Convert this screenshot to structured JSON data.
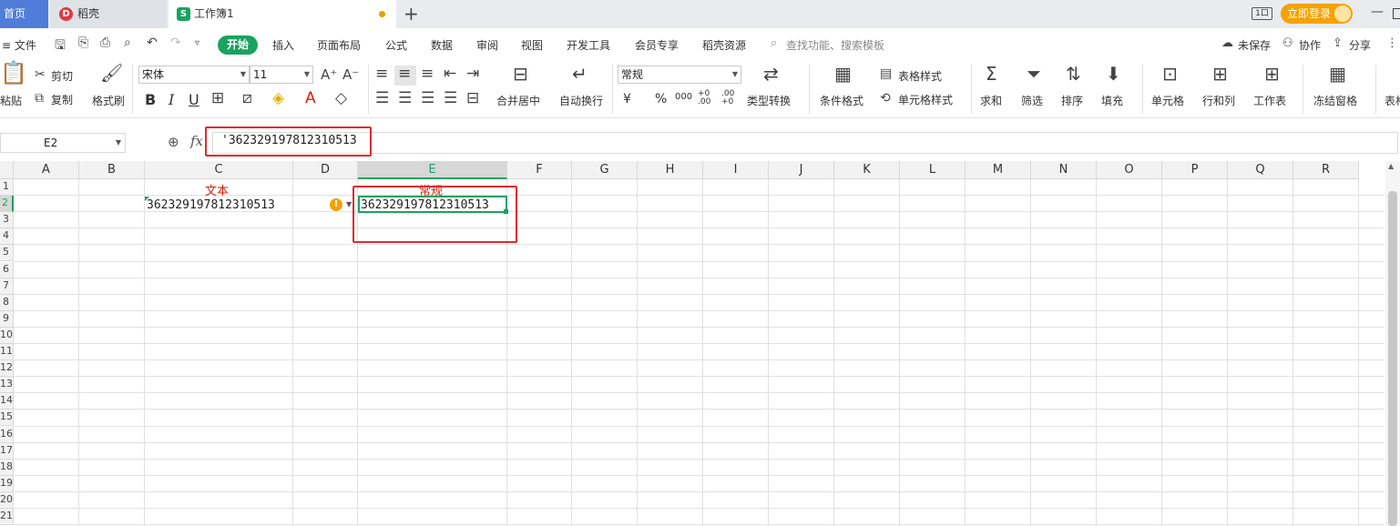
{
  "tabs": {
    "home": "首页",
    "daoke": "稻壳",
    "workbook": "工作簿1",
    "new_tab": "+"
  },
  "title_right": {
    "layout_badge": "1口",
    "login": "立即登录",
    "minimize": "—"
  },
  "menu": {
    "file": "≡ 文件",
    "items": [
      "开始",
      "插入",
      "页面布局",
      "公式",
      "数据",
      "审阅",
      "视图",
      "开发工具",
      "会员专享",
      "稻壳资源"
    ],
    "search": "查找功能、搜索模板",
    "unsaved": "未保存",
    "collab": "协作",
    "share": "分享"
  },
  "ribbon": {
    "paste": "粘贴",
    "cut": "剪切",
    "copy": "复制",
    "format_painter": "格式刷",
    "font_name": "宋体",
    "font_size": "11",
    "bold": "B",
    "italic": "I",
    "underline": "U",
    "merge_center": "合并居中",
    "wrap_text": "自动换行",
    "number_format": "常规",
    "currency": "¥",
    "percent": "%",
    "thousands": "000",
    "inc_decimal": "+0 .00",
    "dec_decimal": ".00 +0",
    "type_convert": "类型转换",
    "cond_format": "条件格式",
    "table_style": "表格样式",
    "cell_style": "单元格样式",
    "sum": "求和",
    "filter": "筛选",
    "sort": "排序",
    "fill": "填充",
    "cell": "单元格",
    "rows_cols": "行和列",
    "worksheet": "工作表",
    "freeze": "冻结窗格",
    "table_tools": "表格"
  },
  "formula_bar": {
    "name_box": "E2",
    "fx": "fx",
    "value": "'362329197812310513"
  },
  "columns": [
    "A",
    "B",
    "C",
    "D",
    "E",
    "F",
    "G",
    "H",
    "I",
    "J",
    "K",
    "L",
    "M",
    "N",
    "O",
    "P",
    "Q",
    "R"
  ],
  "rows": [
    "1",
    "2",
    "3",
    "4",
    "5",
    "6",
    "7",
    "8",
    "9",
    "10",
    "11",
    "12",
    "13",
    "14",
    "15",
    "16",
    "17",
    "18",
    "19",
    "20",
    "21"
  ],
  "cells": {
    "C1": "文本",
    "E1": "常规",
    "C2": "362329197812310513",
    "E2": "362329197812310513"
  },
  "colors": {
    "accent_green": "#1aa260",
    "highlight_red": "#e02b2b",
    "home_tab_blue": "#4f7dd8",
    "login_orange": "#f4a300"
  }
}
